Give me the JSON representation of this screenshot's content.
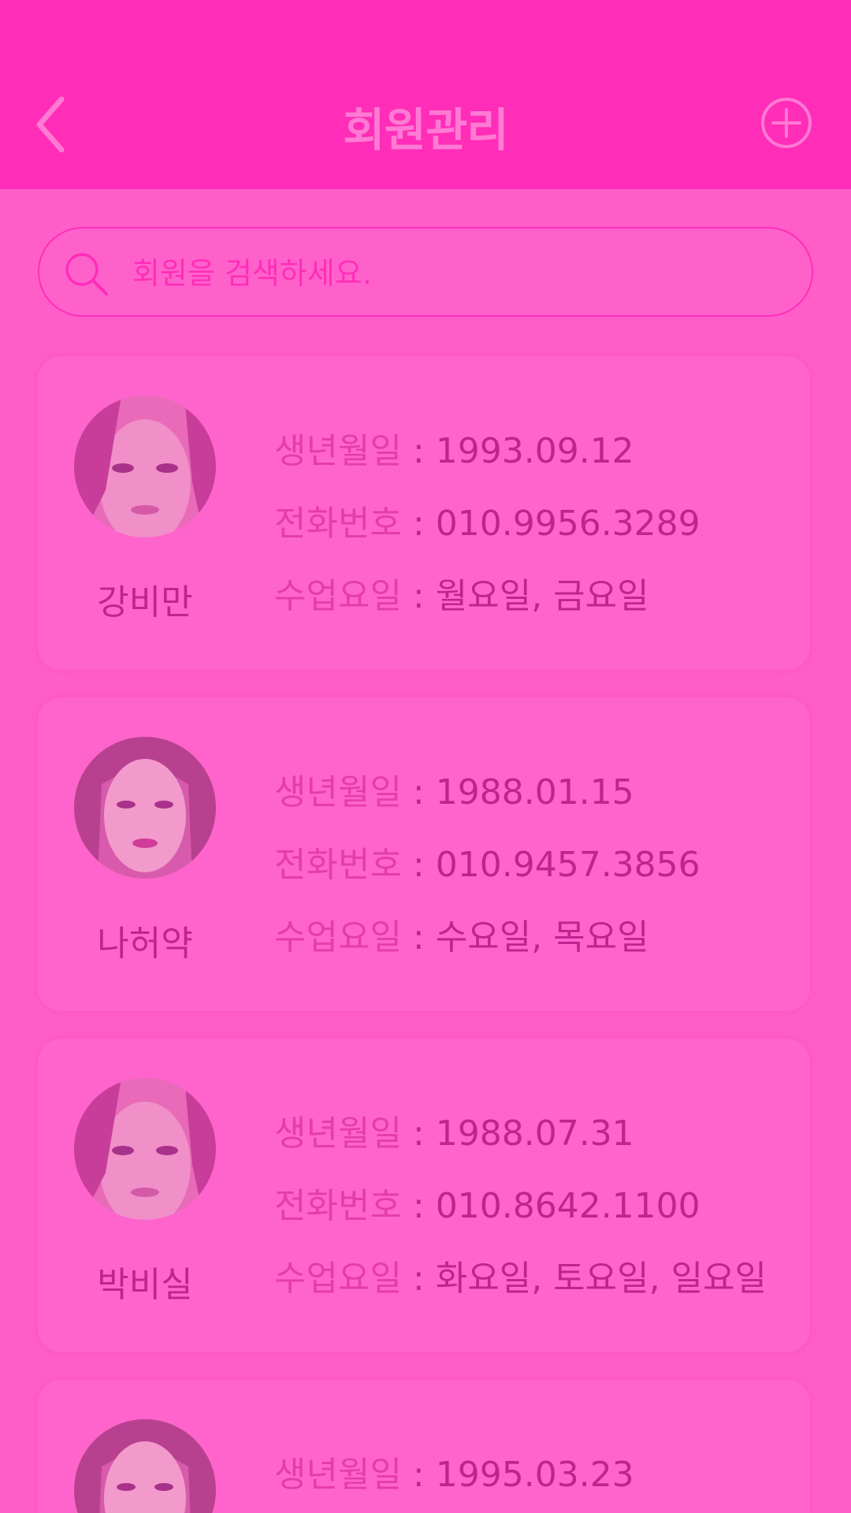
{
  "header": {
    "title": "회원관리"
  },
  "search": {
    "placeholder": "회원을 검색하세요."
  },
  "labels": {
    "birth": "생년월일",
    "phone": "전화번호",
    "days": "수업요일",
    "separator": ":"
  },
  "members": [
    {
      "name": "강비만",
      "birth": "1993.09.12",
      "phone": "010.9956.3289",
      "days": "월요일, 금요일"
    },
    {
      "name": "나허약",
      "birth": "1988.01.15",
      "phone": "010.9457.3856",
      "days": "수요일, 목요일"
    },
    {
      "name": "박비실",
      "birth": "1988.07.31",
      "phone": "010.8642.1100",
      "days": "화요일, 토요일, 일요일"
    },
    {
      "name": "",
      "birth": "1995.03.23",
      "phone": "",
      "days": ""
    }
  ],
  "colors": {
    "header_bg": "#ff2db8",
    "page_bg": "#ff5ec9",
    "card_bg": "#ff64cc",
    "accent_text": "#c2228f",
    "label_text": "#e53cad"
  },
  "icons": {
    "back": "chevron-left-icon",
    "add": "plus-circle-icon",
    "search": "search-icon"
  }
}
